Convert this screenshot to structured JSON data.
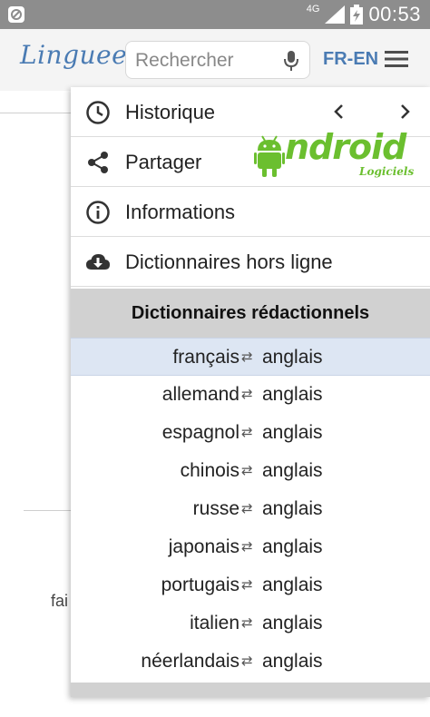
{
  "status_bar": {
    "network": "4G",
    "time": "00:53"
  },
  "header": {
    "logo": "Linguee",
    "search_placeholder": "Rechercher",
    "language_pair": "FR-EN"
  },
  "background": {
    "partial_text": "fai"
  },
  "menu": {
    "items": [
      {
        "label": "Historique",
        "icon": "clock-icon"
      },
      {
        "label": "Partager",
        "icon": "share-icon"
      },
      {
        "label": "Informations",
        "icon": "info-icon"
      },
      {
        "label": "Dictionnaires hors ligne",
        "icon": "cloud-download-icon"
      }
    ],
    "section_title": "Dictionnaires rédactionnels",
    "dictionaries": [
      {
        "source": "français",
        "target": "anglais",
        "selected": true
      },
      {
        "source": "allemand",
        "target": "anglais"
      },
      {
        "source": "espagnol",
        "target": "anglais"
      },
      {
        "source": "chinois",
        "target": "anglais"
      },
      {
        "source": "russe",
        "target": "anglais"
      },
      {
        "source": "japonais",
        "target": "anglais"
      },
      {
        "source": "portugais",
        "target": "anglais"
      },
      {
        "source": "italien",
        "target": "anglais"
      },
      {
        "source": "néerlandais",
        "target": "anglais"
      }
    ]
  },
  "watermark": {
    "title": "ndroid",
    "subtitle": "Logiciels"
  },
  "colors": {
    "accent": "#4a7bb3",
    "selected_row": "#dde6f3",
    "section_bg": "#d1d1d1",
    "watermark": "#6bbf2f"
  }
}
